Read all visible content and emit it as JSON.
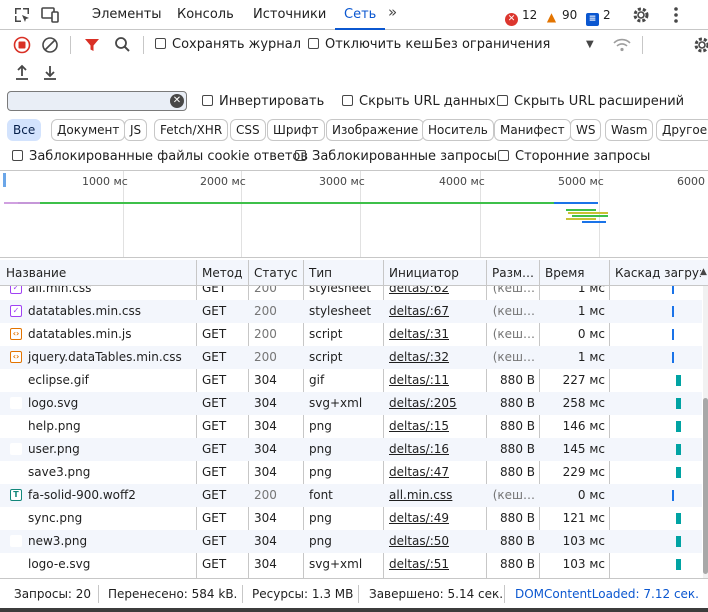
{
  "tabs": {
    "elements": "Элементы",
    "console": "Консоль",
    "sources": "Источники",
    "network": "Сеть",
    "more": "»"
  },
  "badges": {
    "errors": "12",
    "warnings": "90",
    "messages": "2"
  },
  "toolbar": {
    "preserve_log": "Сохранять журнал",
    "disable_cache": "Отключить кеш",
    "throttling": "Без ограничения"
  },
  "filter": {
    "placeholder": "",
    "invert": "Инвертировать",
    "hide_data_urls": "Скрыть URL данных",
    "hide_extension_urls": "Скрыть URL расширений"
  },
  "chips": [
    "Все",
    "Документ",
    "JS",
    "Fetch/XHR",
    "CSS",
    "Шрифт",
    "Изображение",
    "Носитель",
    "Манифест",
    "WS",
    "Wasm",
    "Другое"
  ],
  "options": {
    "blocked_cookies": "Заблокированные файлы cookie ответов",
    "blocked_requests": "Заблокированные запросы",
    "third_party": "Сторонние запросы"
  },
  "overview_ticks": [
    "1000 мс",
    "2000 мс",
    "3000 мс",
    "4000 мс",
    "5000 мс",
    "6000 мс"
  ],
  "columns": {
    "name": "Название",
    "method": "Метод",
    "status": "Статус",
    "type": "Тип",
    "initiator": "Инициатор",
    "size": "Разм…",
    "time": "Время",
    "waterfall": "Каскад загрузки"
  },
  "rows": [
    {
      "name": "all.min.css",
      "method": "GET",
      "status": "200",
      "type": "stylesheet",
      "initiator": "deltas/:62",
      "size": "(кеш…",
      "time": "1 мс",
      "icon": "css"
    },
    {
      "name": "datatables.min.css",
      "method": "GET",
      "status": "200",
      "type": "stylesheet",
      "initiator": "deltas/:67",
      "size": "(кеш…",
      "time": "1 мс",
      "icon": "css"
    },
    {
      "name": "datatables.min.js",
      "method": "GET",
      "status": "200",
      "type": "script",
      "initiator": "deltas/:31",
      "size": "(кеш…",
      "time": "0 мс",
      "icon": "js"
    },
    {
      "name": "jquery.dataTables.min.css",
      "method": "GET",
      "status": "200",
      "type": "script",
      "initiator": "deltas/:32",
      "size": "(кеш…",
      "time": "1 мс",
      "icon": "js"
    },
    {
      "name": "eclipse.gif",
      "method": "GET",
      "status": "304",
      "type": "gif",
      "initiator": "deltas/:11",
      "size": "880 В",
      "time": "227 мс",
      "icon": "img"
    },
    {
      "name": "logo.svg",
      "method": "GET",
      "status": "304",
      "type": "svg+xml",
      "initiator": "deltas/:205",
      "size": "880 В",
      "time": "258 мс",
      "icon": "img"
    },
    {
      "name": "help.png",
      "method": "GET",
      "status": "304",
      "type": "png",
      "initiator": "deltas/:15",
      "size": "880 В",
      "time": "146 мс",
      "icon": "img"
    },
    {
      "name": "user.png",
      "method": "GET",
      "status": "304",
      "type": "png",
      "initiator": "deltas/:16",
      "size": "880 В",
      "time": "145 мс",
      "icon": "img"
    },
    {
      "name": "save3.png",
      "method": "GET",
      "status": "304",
      "type": "png",
      "initiator": "deltas/:47",
      "size": "880 В",
      "time": "229 мс",
      "icon": "img"
    },
    {
      "name": "fa-solid-900.woff2",
      "method": "GET",
      "status": "200",
      "type": "font",
      "initiator": "all.min.css",
      "size": "(кеш…",
      "time": "0 мс",
      "icon": "font"
    },
    {
      "name": "sync.png",
      "method": "GET",
      "status": "304",
      "type": "png",
      "initiator": "deltas/:49",
      "size": "880 В",
      "time": "121 мс",
      "icon": "img"
    },
    {
      "name": "new3.png",
      "method": "GET",
      "status": "304",
      "type": "png",
      "initiator": "deltas/:50",
      "size": "880 В",
      "time": "103 мс",
      "icon": "img"
    },
    {
      "name": "logo-e.svg",
      "method": "GET",
      "status": "304",
      "type": "svg+xml",
      "initiator": "deltas/:51",
      "size": "880 В",
      "time": "103 мс",
      "icon": "img"
    }
  ],
  "status_bar": {
    "requests": "Запросы: 20",
    "transferred": "Перенесено: 584 kB.",
    "resources": "Ресурсы: 1.3 MB",
    "finished": "Завершено: 5.14 сек.",
    "dom_content_loaded": "DOMContentLoaded: 7.12 сек."
  },
  "colors": {
    "accent": "#0b57d0",
    "record_red": "#d93025",
    "filter_red": "#d93025",
    "error_red": "#dc362e",
    "warning_orange": "#e37400",
    "waterfall_blue": "#1a73e8",
    "waterfall_teal": "#00a3a3"
  }
}
